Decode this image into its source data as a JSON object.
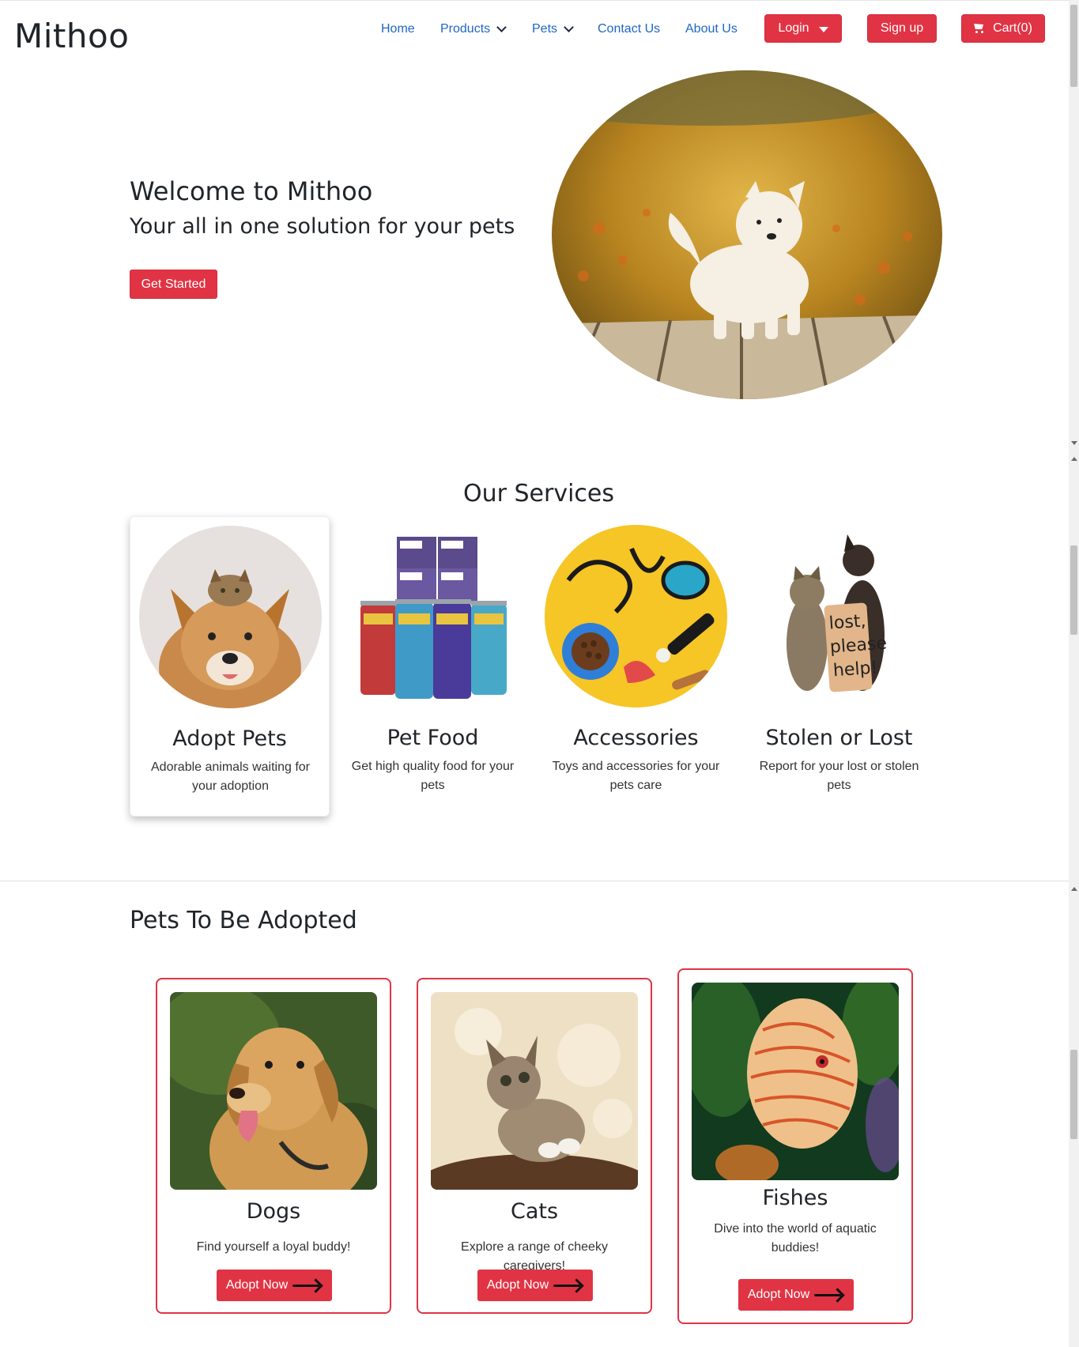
{
  "brand": "Mithoo",
  "nav": {
    "home": "Home",
    "products": "Products",
    "pets": "Pets",
    "contact": "Contact Us",
    "about": "About Us",
    "login": "Login",
    "signup": "Sign up",
    "cart": "Cart(0)"
  },
  "hero": {
    "title": "Welcome to Mithoo",
    "subtitle": "Your all in one solution for your pets",
    "cta": "Get Started"
  },
  "services": {
    "title": "Our Services",
    "items": [
      {
        "title": "Adopt Pets",
        "desc": "Adorable animals waiting for your adoption",
        "image": "dog-and-cat-photo"
      },
      {
        "title": "Pet Food",
        "desc": "Get high quality food for your pets",
        "image": "pet-food-cans-photo"
      },
      {
        "title": "Accessories",
        "desc": "Toys and accessories for your pets care",
        "image": "pet-accessories-photo"
      },
      {
        "title": "Stolen or Lost",
        "desc": "Report for your lost or stolen pets",
        "image": "lost-pets-photo"
      }
    ]
  },
  "adopt": {
    "title": "Pets To Be Adopted",
    "pets": [
      {
        "title": "Dogs",
        "desc": "Find yourself a loyal buddy!",
        "button": "Adopt Now",
        "image": "golden-retriever-photo"
      },
      {
        "title": "Cats",
        "desc": "Explore a range of cheeky caregivers!",
        "button": "Adopt Now",
        "image": "kitten-photo"
      },
      {
        "title": "Fishes",
        "desc": "Dive into the world of aquatic buddies!",
        "button": "Adopt Now",
        "image": "discus-fish-photo"
      }
    ]
  },
  "lost_sign_text": "lost, please help!",
  "colors": {
    "accent": "#e03444",
    "link": "#1f66c6",
    "text": "#212529"
  }
}
